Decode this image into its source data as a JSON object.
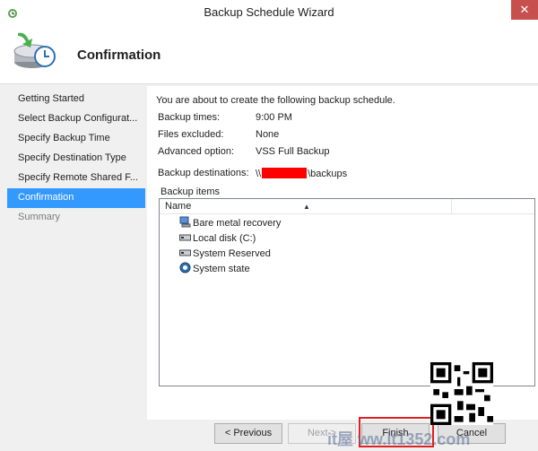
{
  "window": {
    "title": "Backup Schedule Wizard",
    "close_glyph": "✕"
  },
  "header": {
    "title": "Confirmation",
    "icon": "backup-clock-icon"
  },
  "nav": {
    "items": [
      {
        "label": "Getting Started",
        "state": "normal"
      },
      {
        "label": "Select Backup Configurat...",
        "state": "normal"
      },
      {
        "label": "Specify Backup Time",
        "state": "normal"
      },
      {
        "label": "Specify Destination Type",
        "state": "normal"
      },
      {
        "label": "Specify Remote Shared F...",
        "state": "normal"
      },
      {
        "label": "Confirmation",
        "state": "active"
      },
      {
        "label": "Summary",
        "state": "disabled"
      }
    ]
  },
  "content": {
    "intro": "You are about to create the following backup schedule.",
    "backup_times_label": "Backup times:",
    "backup_times_value": "9:00 PM",
    "files_excluded_label": "Files excluded:",
    "files_excluded_value": "None",
    "advanced_option_label": "Advanced option:",
    "advanced_option_value": "VSS Full Backup",
    "destinations_label": "Backup destinations:",
    "destinations_prefix": "\\\\",
    "destinations_suffix": "\\backups",
    "backup_items_label": "Backup items",
    "list": {
      "column_name": "Name",
      "items": [
        {
          "label": "Bare metal recovery",
          "icon": "bare-metal-icon"
        },
        {
          "label": "Local disk (C:)",
          "icon": "disk-drive-icon"
        },
        {
          "label": "System Reserved",
          "icon": "disk-drive-icon"
        },
        {
          "label": "System state",
          "icon": "system-state-icon"
        }
      ]
    }
  },
  "footer": {
    "previous_label": "< Previous",
    "next_label": "Next >",
    "finish_label": "Finish",
    "cancel_label": "Cancel"
  },
  "watermark": {
    "text": "it屋 ww.it1352.com"
  },
  "colors": {
    "accent": "#3399ff",
    "close": "#c7504f",
    "redaction": "#ff0000",
    "highlight": "#e02020"
  }
}
